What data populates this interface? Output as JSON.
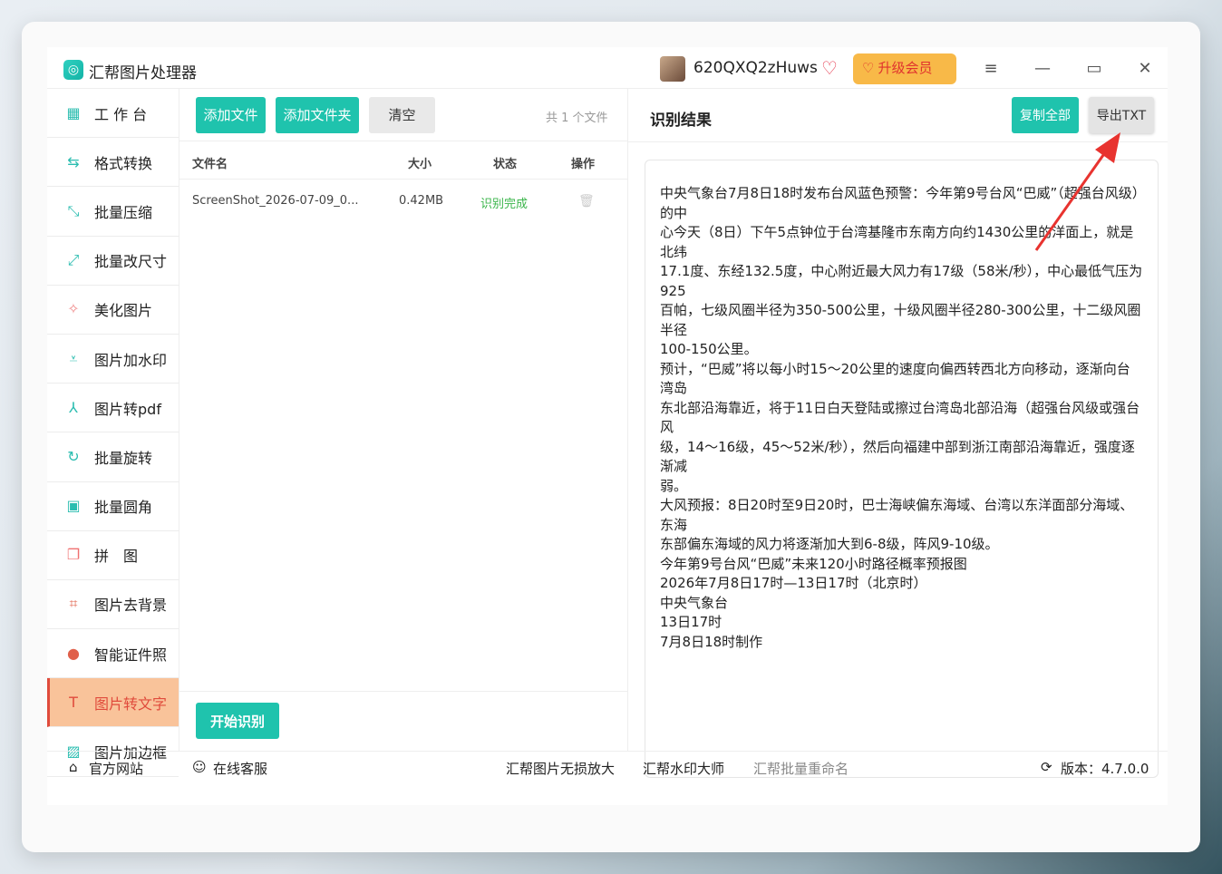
{
  "window": {
    "app_title": "汇帮图片处理器",
    "username": "620QXQ2zHuws",
    "upgrade_label": "升级会员",
    "menu_icon": "≡",
    "minimize_icon": "—",
    "maximize_icon": "▭",
    "close_icon": "✕"
  },
  "sidebar": {
    "items": [
      {
        "label": "工 作 台",
        "icon": "grid-icon"
      },
      {
        "label": "格式转换",
        "icon": "convert-icon"
      },
      {
        "label": "批量压缩",
        "icon": "compress-icon"
      },
      {
        "label": "批量改尺寸",
        "icon": "resize-icon"
      },
      {
        "label": "美化图片",
        "icon": "beautify-icon"
      },
      {
        "label": "图片加水印",
        "icon": "watermark-icon"
      },
      {
        "label": "图片转pdf",
        "icon": "pdf-icon"
      },
      {
        "label": "批量旋转",
        "icon": "rotate-icon"
      },
      {
        "label": "批量圆角",
        "icon": "round-corner-icon"
      },
      {
        "label": "拼　图",
        "icon": "collage-icon"
      },
      {
        "label": "图片去背景",
        "icon": "crop-icon"
      },
      {
        "label": "智能证件照",
        "icon": "person-icon"
      },
      {
        "label": "图片转文字",
        "icon": "text-icon",
        "active": true
      },
      {
        "label": "图片加边框",
        "icon": "frame-icon"
      }
    ]
  },
  "file_panel": {
    "add_file": "添加文件",
    "add_folder": "添加文件夹",
    "clear": "清空",
    "file_count": "共 1 个文件",
    "columns": {
      "name": "文件名",
      "size": "大小",
      "status": "状态",
      "action": "操作"
    },
    "rows": [
      {
        "name": "ScreenShot_2026-07-09_0...",
        "size": "0.42MB",
        "status": "识别完成"
      }
    ],
    "start_button": "开始识别"
  },
  "result_panel": {
    "title": "识别结果",
    "copy_all": "复制全部",
    "export_txt": "导出TXT",
    "lines": [
      "中央气象台7月8日18时发布台风蓝色预警：今年第9号台风“巴威”（超强台风级）的中",
      "心今天（8日）下午5点钟位于台湾基隆市东南方向约1430公里的洋面上，就是北纬",
      "17.1度、东经132.5度，中心附近最大风力有17级（58米/秒），中心最低气压为925",
      "百帕，七级风圈半径为350-500公里，十级风圈半径280-300公里，十二级风圈半径",
      "100-150公里。",
      "预计，“巴威”将以每小时15～20公里的速度向偏西转西北方向移动，逐渐向台湾岛",
      "东北部沿海靠近，将于11日白天登陆或擦过台湾岛北部沿海（超强台风级或强台风",
      "级，14～16级，45～52米/秒），然后向福建中部到浙江南部沿海靠近，强度逐渐减",
      "弱。",
      "大风预报：8日20时至9日20时，巴士海峡偏东海域、台湾以东洋面部分海域、东海",
      "东部偏东海域的风力将逐渐加大到6-8级，阵风9-10级。",
      "今年第9号台风“巴威”未来120小时路径概率预报图",
      "2026年7月8日17时—13日17时（北京时）",
      "中央气象台",
      "13日17时",
      "7月8日18时制作"
    ]
  },
  "footer": {
    "official_site": "官方网站",
    "online_service": "在线客服",
    "link1": "汇帮图片无损放大",
    "link2": "汇帮水印大师",
    "link3": "汇帮批量重命名",
    "version": "版本：4.7.0.0"
  }
}
